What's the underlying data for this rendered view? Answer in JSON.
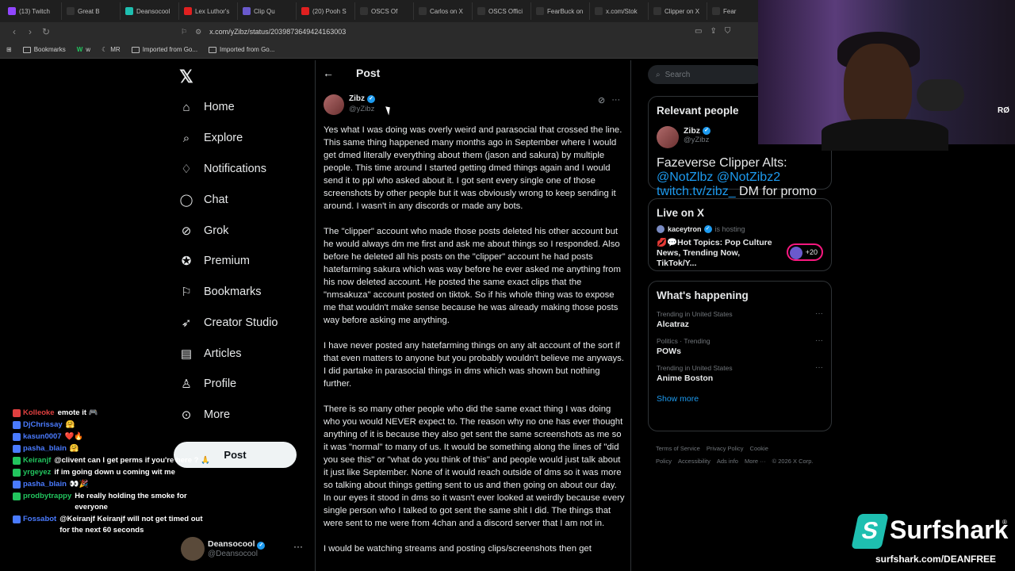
{
  "browser": {
    "tabs": [
      {
        "label": "(13) Twitch",
        "color": "#9146ff"
      },
      {
        "label": "Great B",
        "color": "#333333"
      },
      {
        "label": "Deansocool",
        "color": "#1ebfb0"
      },
      {
        "label": "Lex Luthor's",
        "color": "#e02020"
      },
      {
        "label": "Clip Qu",
        "color": "#6a5acd"
      },
      {
        "label": "(20) Pooh S",
        "color": "#e02020"
      },
      {
        "label": "OSCS Of",
        "color": "#333333"
      },
      {
        "label": "Carlos on X",
        "color": "#333333"
      },
      {
        "label": "OSCS Offici",
        "color": "#333333"
      },
      {
        "label": "FearBuck on",
        "color": "#333333"
      },
      {
        "label": "x.com/Stok",
        "color": "#333333"
      },
      {
        "label": "Clipper on X",
        "color": "#333333"
      },
      {
        "label": "Fear",
        "color": "#333333"
      }
    ],
    "url": "x.com/yZibz/status/2039873649424163003",
    "bookmarks": [
      "Bookmarks",
      "w",
      "MR",
      "Imported from Go...",
      "Imported from Go..."
    ]
  },
  "nav": {
    "items": [
      {
        "label": "Home",
        "icon": "home-icon",
        "glyph": "⌂"
      },
      {
        "label": "Explore",
        "icon": "search-icon",
        "glyph": "⌕"
      },
      {
        "label": "Notifications",
        "icon": "bell-icon",
        "glyph": "♢"
      },
      {
        "label": "Chat",
        "icon": "chat-icon",
        "glyph": "◯"
      },
      {
        "label": "Grok",
        "icon": "grok-icon",
        "glyph": "⊘"
      },
      {
        "label": "Premium",
        "icon": "premium-icon",
        "glyph": "✪"
      },
      {
        "label": "Bookmarks",
        "icon": "bookmark-icon",
        "glyph": "⚐"
      },
      {
        "label": "Creator Studio",
        "icon": "rocket-icon",
        "glyph": "➶"
      },
      {
        "label": "Articles",
        "icon": "article-icon",
        "glyph": "▤"
      },
      {
        "label": "Profile",
        "icon": "profile-icon",
        "glyph": "♙"
      },
      {
        "label": "More",
        "icon": "more-icon",
        "glyph": "⊙"
      }
    ],
    "post_button": "Post",
    "account": {
      "name": "Deansocool",
      "handle": "@Deansocool"
    }
  },
  "post": {
    "header": "Post",
    "author": {
      "name": "Zibz",
      "handle": "@yZibz"
    },
    "paragraphs": [
      "Yes what I was doing was overly weird and parasocial that crossed the line. This same thing happened many months ago in September where I would get dmed literally everything about them (jason and sakura) by multiple people. This time around I started getting dmed things again and I would send it to ppl who asked about it. I got sent every single one of those screenshots by other people but it was obviously wrong to keep sending it around. I wasn't in any discords or made any bots.",
      "The \"clipper\" account who made those posts deleted his other account but he would always dm me first and ask me about things so I responded. Also before he deleted all his posts on the \"clipper\" account he had posts hatefarming sakura which was way before he ever asked me anything from his now deleted account. He posted the same exact clips that the \"nmsakuza\" account posted on tiktok. So if his whole thing was to expose me that wouldn't make sense because he was already making those posts way before asking me anything.",
      "I have never posted any hatefarming things on any alt account of the sort if that even matters to anyone but you probably wouldn't believe me anyways. I did partake in parasocial things in dms which was shown but nothing further.",
      "There is so many other people who did the same exact thing I was doing who you would NEVER expect to. The reason why no one has ever thought anything of it is because they also get sent the same screenshots as me so it was \"normal\" to many of us. It would be something along the lines of \"did you see this\" or \"what do you think of this\" and people would just talk about it just like September. None of it would reach outside of dms so it was more so talking about things getting sent to us and then going on about our day. In our eyes it stood in dms so it wasn't ever looked at weirdly because every single person who I talked to got sent the same shit I did. The things that were sent to me were from 4chan and a discord server that I am not in.",
      "I would be watching streams and posting clips/screenshots then get"
    ]
  },
  "sidebar": {
    "search_placeholder": "Search",
    "relevant": {
      "title": "Relevant people",
      "name": "Zibz",
      "handle": "@yZibz",
      "bio_prefix": "Fazeverse Clipper Alts: ",
      "bio_link1": "@NotZlbz",
      "bio_link2": "@NotZibz2 twitch.tv/zibz_",
      "bio_suffix": " DM for promo"
    },
    "live": {
      "title": "Live on X",
      "host": "kaceytron",
      "host_status": "is hosting",
      "stream_title": "💋💬Hot Topics: Pop Culture News, Trending Now, TikTok/Y...",
      "count": "+20"
    },
    "happening": {
      "title": "What's happening",
      "trends": [
        {
          "context": "Trending in United States",
          "topic": "Alcatraz"
        },
        {
          "context": "Politics · Trending",
          "topic": "POWs"
        },
        {
          "context": "Trending in United States",
          "topic": "Anime Boston"
        }
      ],
      "show_more": "Show more"
    },
    "footer": [
      "Terms of Service",
      "Privacy Policy",
      "Cookie Policy",
      "Accessibility",
      "Ads info",
      "More ···",
      "© 2026 X Corp."
    ]
  },
  "chat": [
    {
      "user": "Kolleoke",
      "msg": "emote it 🎮",
      "color": "#e04040"
    },
    {
      "user": "DjChrissay",
      "msg": "🤗",
      "color": "#4a7bff"
    },
    {
      "user": "kasun0007",
      "msg": "❤️🔥",
      "color": "#4a7bff"
    },
    {
      "user": "pasha_blain",
      "msg": "🤗",
      "color": "#4a7bff"
    },
    {
      "user": "Keiranjf",
      "msg": "@clivent can I get perms if you're here ? 🙏",
      "color": "#22c55e"
    },
    {
      "user": "yrgeyez",
      "msg": "if im going down u coming wit me",
      "color": "#22c55e"
    },
    {
      "user": "pasha_blain",
      "msg": "👀🎉",
      "color": "#4a7bff"
    },
    {
      "user": "prodbytrappy",
      "msg": "He really holding the smoke for everyone",
      "color": "#22c55e"
    },
    {
      "user": "Fossabot",
      "msg": "@Keiranjf Keiranjf will not get timed out for the next 60 seconds",
      "color": "#4a7bff"
    }
  ],
  "sponsor": {
    "brand": "Surfshark",
    "url": "surfshark.com/DEANFREE"
  },
  "webcam_logo": "RØ"
}
